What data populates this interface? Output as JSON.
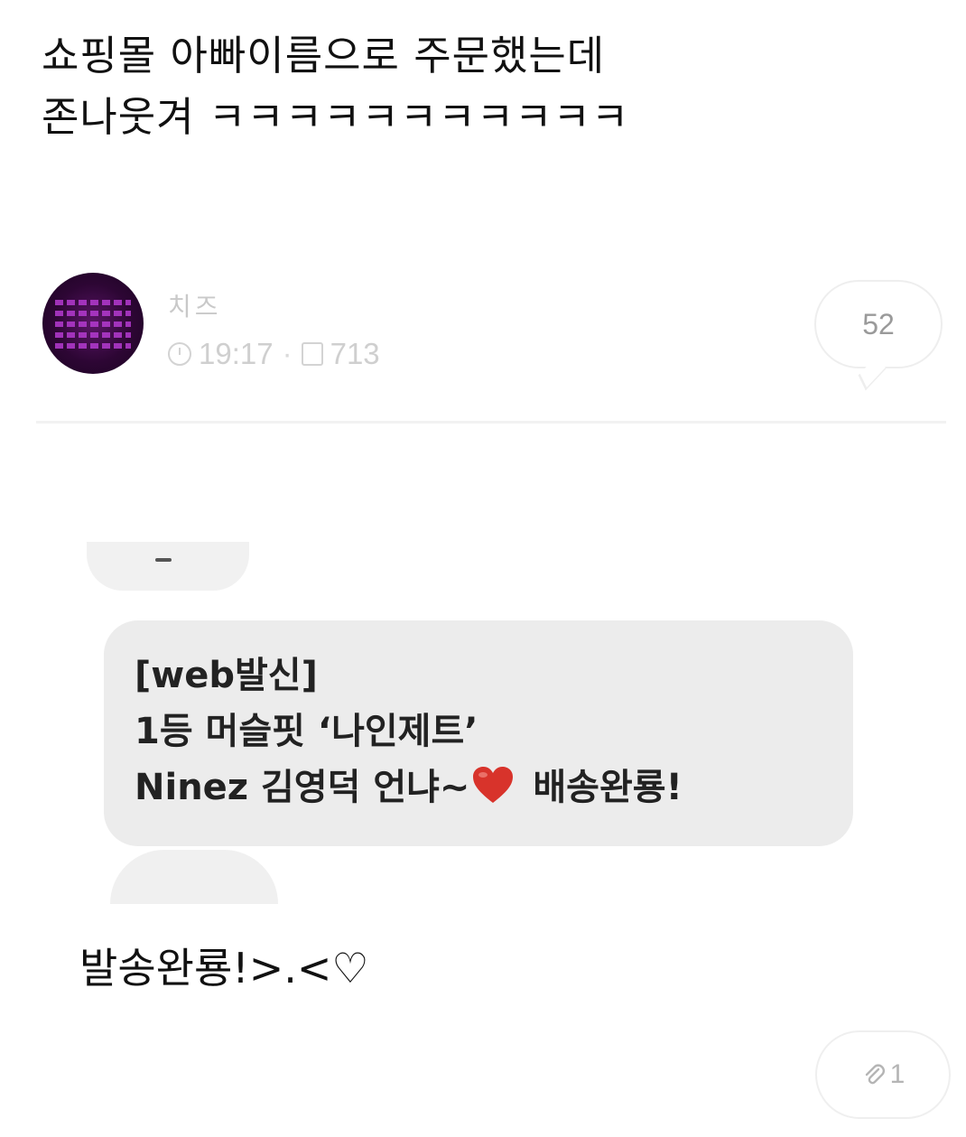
{
  "caption": {
    "line1": "쇼핑몰 아빠이름으로 주문했는데",
    "line2": "존나웃겨 ㅋㅋㅋㅋㅋㅋㅋㅋㅋㅋㅋ"
  },
  "post": {
    "author": "치즈",
    "time": "19:17",
    "views": "713",
    "comment_count": "52"
  },
  "sms": {
    "line1": "[web발신]",
    "line2": "1등 머슬핏 ‘나인제트’",
    "line3_before": "Ninez 김영덕 언냐~",
    "line3_after": " 배송완룡!"
  },
  "reply": {
    "text": "발송완룡!>.<♡"
  },
  "attachment": {
    "count": "1"
  },
  "colors": {
    "avatar": "#2d0634",
    "bubble": "#ececec",
    "heart": "#d8332b"
  }
}
